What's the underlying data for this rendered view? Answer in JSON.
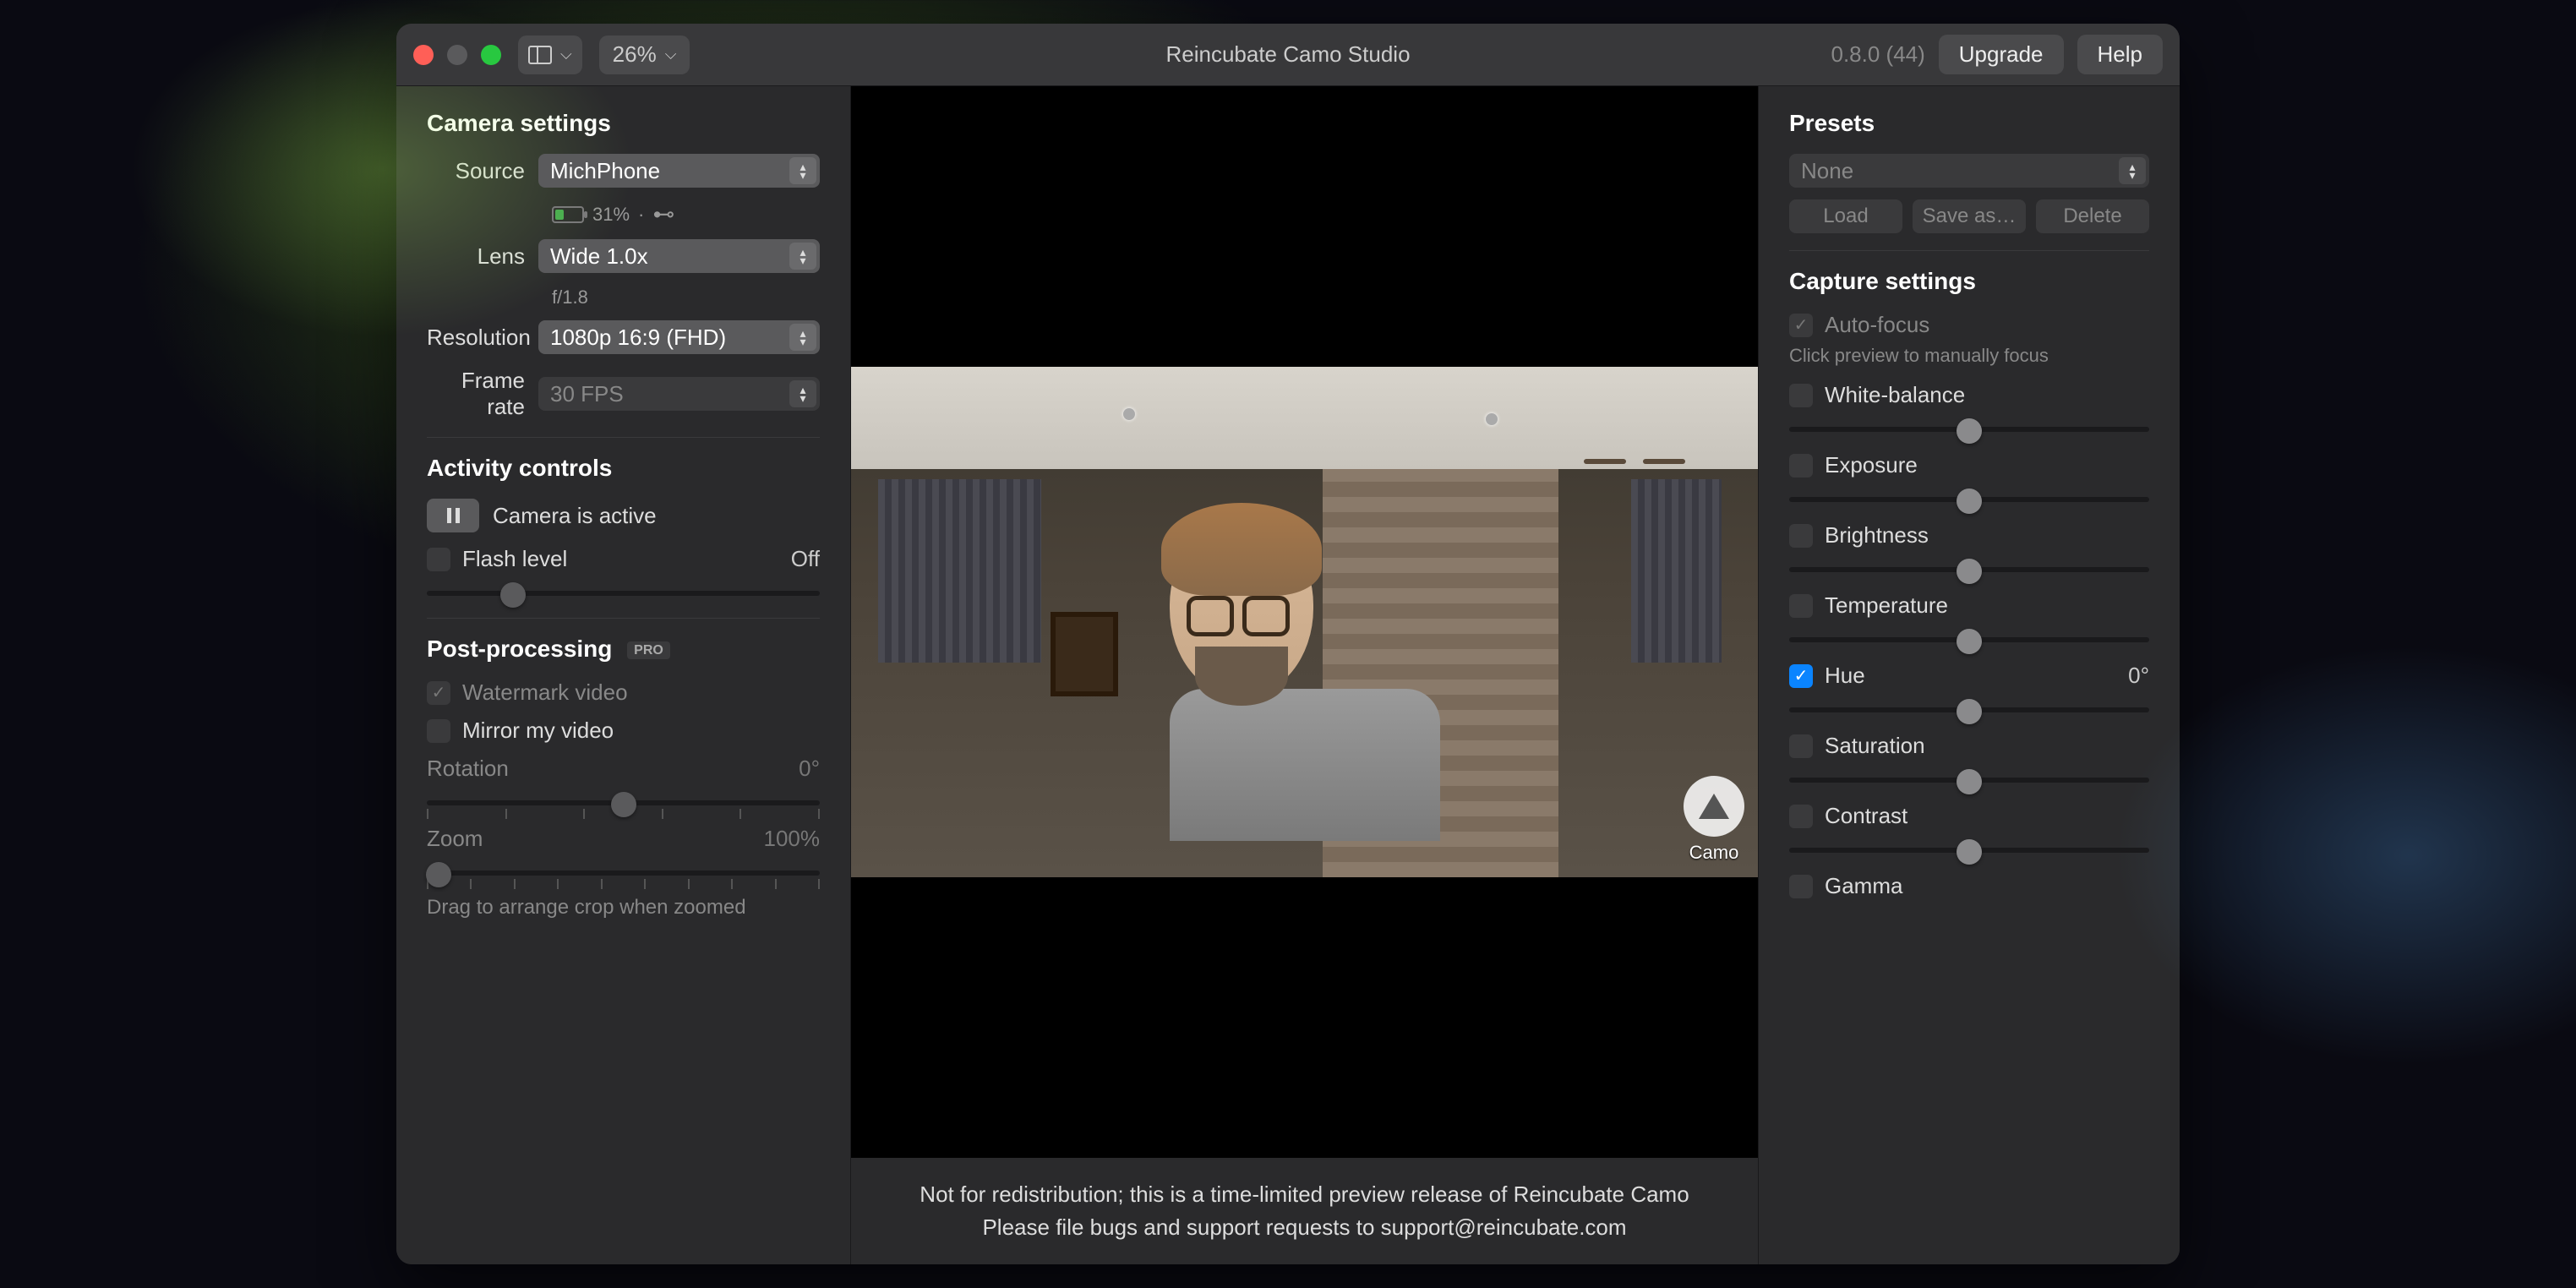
{
  "titlebar": {
    "zoom_level": "26%",
    "app_title": "Reincubate Camo Studio",
    "version": "0.8.0 (44)",
    "upgrade": "Upgrade",
    "help": "Help"
  },
  "left": {
    "camera_settings_title": "Camera settings",
    "source_label": "Source",
    "source_value": "MichPhone",
    "battery_pct": "31%",
    "lens_label": "Lens",
    "lens_value": "Wide 1.0x",
    "aperture": "f/1.8",
    "resolution_label": "Resolution",
    "resolution_value": "1080p 16:9 (FHD)",
    "framerate_label": "Frame rate",
    "framerate_value": "30 FPS",
    "activity_title": "Activity controls",
    "camera_status": "Camera is active",
    "flash_label": "Flash level",
    "flash_value": "Off",
    "post_title": "Post-processing",
    "pro_badge": "PRO",
    "watermark_label": "Watermark video",
    "mirror_label": "Mirror my video",
    "rotation_label": "Rotation",
    "rotation_value": "0°",
    "zoom_label": "Zoom",
    "zoom_value": "100%",
    "drag_hint": "Drag to arrange crop when zoomed"
  },
  "center": {
    "watermark_text": "Camo",
    "note_line1": "Not for redistribution; this is a time-limited preview release of Reincubate Camo",
    "note_line2": "Please file bugs and support requests to support@reincubate.com"
  },
  "right": {
    "presets_title": "Presets",
    "preset_value": "None",
    "load": "Load",
    "save_as": "Save as…",
    "delete": "Delete",
    "capture_title": "Capture settings",
    "autofocus": "Auto-focus",
    "autofocus_hint": "Click preview to manually focus",
    "white_balance": "White-balance",
    "exposure": "Exposure",
    "brightness": "Brightness",
    "temperature": "Temperature",
    "hue": "Hue",
    "hue_value": "0°",
    "saturation": "Saturation",
    "contrast": "Contrast",
    "gamma": "Gamma"
  }
}
